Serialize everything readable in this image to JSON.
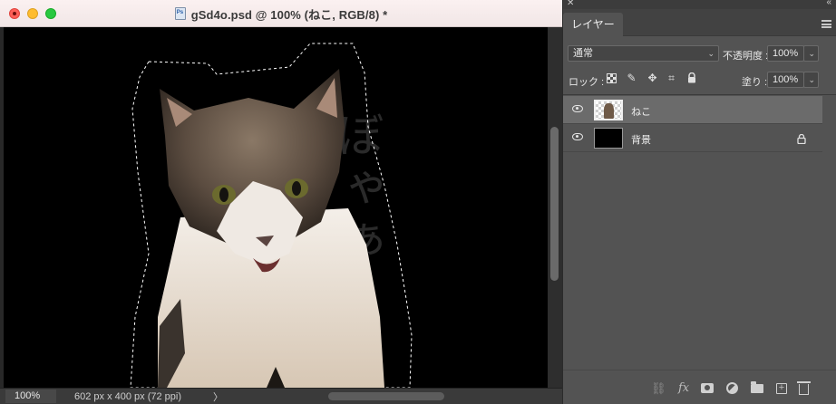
{
  "document": {
    "title": "gSd4o.psd @ 100% (ねこ, RGB/8) *",
    "canvas_text": "ぼゃぁ",
    "status": {
      "zoom": "100%",
      "info": "602 px x 400 px (72 ppi)",
      "arrow": "〉"
    }
  },
  "layers_panel": {
    "tab_label": "レイヤー",
    "blend_mode": "通常",
    "opacity_label": "不透明度 :",
    "opacity_value": "100%",
    "lock_label": "ロック :",
    "fill_label": "塗り :",
    "fill_value": "100%",
    "layers": [
      {
        "name": "ねこ",
        "visible": true,
        "selected": true
      },
      {
        "name": "背景",
        "visible": true,
        "locked": true
      }
    ],
    "bottom_icons": [
      "link-icon",
      "fx-icon",
      "mask-icon",
      "adjustment-icon",
      "folder-icon",
      "new-layer-icon",
      "trash-icon"
    ],
    "fx_label": "fx"
  },
  "colors": {
    "panel_bg": "#535353",
    "selected_row": "#6b6b6b",
    "titlebar": "#f6ecec"
  }
}
